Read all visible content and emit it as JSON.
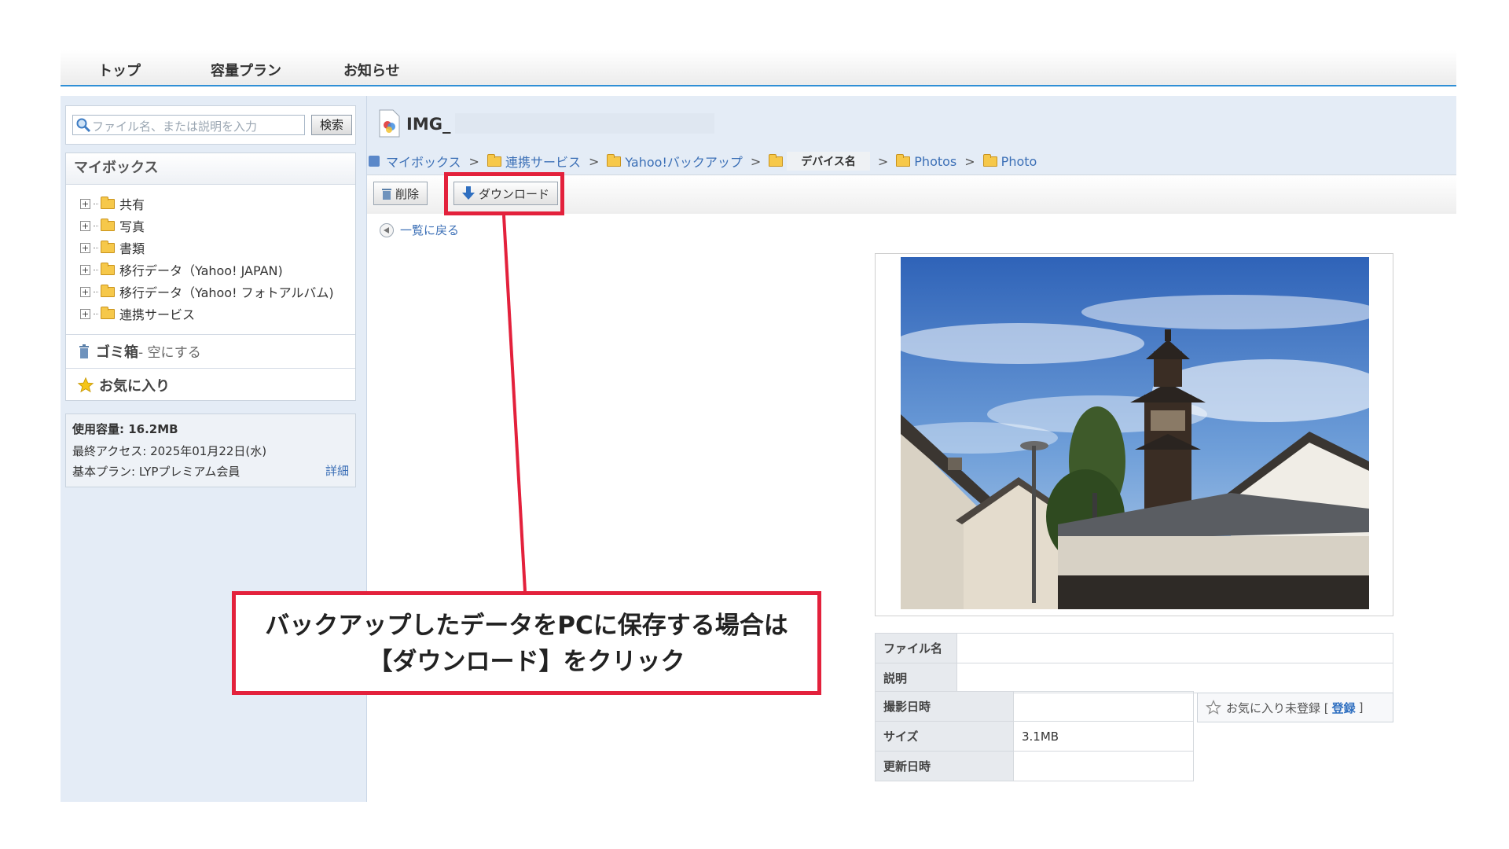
{
  "nav": {
    "items": [
      "トップ",
      "容量プラン",
      "お知らせ"
    ]
  },
  "search": {
    "placeholder": "ファイル名、または説明を入力",
    "button": "検索"
  },
  "sidebar": {
    "title": "マイボックス",
    "tree": [
      "共有",
      "写真",
      "書類",
      "移行データ（Yahoo! JAPAN)",
      "移行データ（Yahoo! フォトアルバム)",
      "連携サービス"
    ],
    "trash": "ゴミ箱",
    "trash_action": "- 空にする",
    "favorites": "お気に入り"
  },
  "usage": {
    "used": "使用容量: 16.2MB",
    "last_access": "最終アクセス: 2025年01月22日(水)",
    "plan": "基本プラン: LYPプレミアム会員",
    "detail": "詳細"
  },
  "file": {
    "title": "IMG_"
  },
  "breadcrumb": {
    "items": [
      "マイボックス",
      "連携サービス",
      "Yahoo!バックアップ",
      "デバイス名",
      "Photos",
      "Photo"
    ],
    "separator": ">"
  },
  "toolbar": {
    "delete": "削除",
    "download": "ダウンロード"
  },
  "back": "一覧に戻る",
  "info": {
    "filename_label": "ファイル名",
    "filename_value": "",
    "description_label": "説明",
    "description_value": "",
    "shot_label": "撮影日時",
    "shot_value": "",
    "size_label": "サイズ",
    "size_value": "3.1MB",
    "updated_label": "更新日時",
    "updated_value": ""
  },
  "favorite_status": {
    "text": "お気に入り未登録 [",
    "register": "登録",
    "close": "]"
  },
  "callout": {
    "line1": "バックアップしたデータをPCに保存する場合は",
    "line2": "【ダウンロード】をクリック"
  },
  "colors": {
    "annotation": "#e3213c",
    "link": "#3b6fb6",
    "panel": "#e4ecf6",
    "accent_line": "#2f8fd6"
  }
}
